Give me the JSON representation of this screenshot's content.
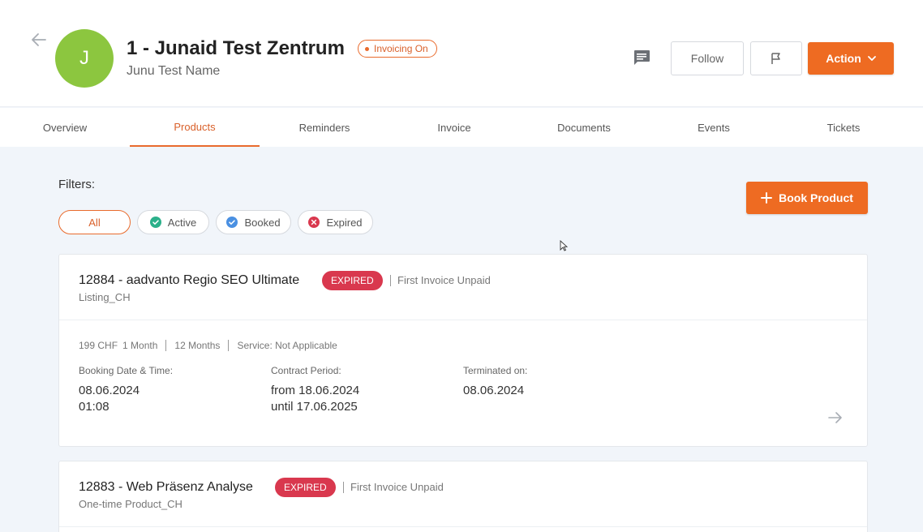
{
  "header": {
    "avatar_initial": "J",
    "title": "1 - Junaid Test Zentrum",
    "badge": "Invoicing On",
    "subtitle": "Junu Test Name",
    "buttons": {
      "follow": "Follow",
      "action": "Action"
    },
    "icons": [
      "back-arrow-icon",
      "message-icon",
      "flag-icon",
      "chevron-down-icon"
    ]
  },
  "tabs": [
    "Overview",
    "Products",
    "Reminders",
    "Invoice",
    "Documents",
    "Events",
    "Tickets"
  ],
  "active_tab": "Products",
  "filters": {
    "label": "Filters:",
    "chips": [
      {
        "label": "All",
        "active": true
      },
      {
        "label": "Active",
        "icon": "check-circle-icon",
        "color": "#2bb08a"
      },
      {
        "label": "Booked",
        "icon": "check-circle-icon",
        "color": "#4a90e2"
      },
      {
        "label": "Expired",
        "icon": "x-circle-icon",
        "color": "#d9384e"
      }
    ]
  },
  "book_button": "Book Product",
  "products": [
    {
      "title": "12884 - aadvanto Regio SEO Ultimate",
      "status": "EXPIRED",
      "invoice_status": "First Invoice Unpaid",
      "category": "Listing_CH",
      "price": "199 CHF",
      "billing": "1 Month",
      "duration": "12 Months",
      "service": "Service: Not Applicable",
      "booking_label": "Booking Date & Time:",
      "booking_date": "08.06.2024",
      "booking_time": "01:08",
      "contract_label": "Contract Period:",
      "contract_from": "from 18.06.2024",
      "contract_until": "until 17.06.2025",
      "terminated_label": "Terminated on:",
      "terminated_date": "08.06.2024"
    },
    {
      "title": "12883 - Web Präsenz Analyse",
      "status": "EXPIRED",
      "invoice_status": "First Invoice Unpaid",
      "category": "One-time Product_CH"
    }
  ],
  "colors": {
    "accent": "#ee6b22",
    "expired": "#d9384e",
    "avatar": "#8cc63f",
    "background": "#f1f5fa"
  }
}
